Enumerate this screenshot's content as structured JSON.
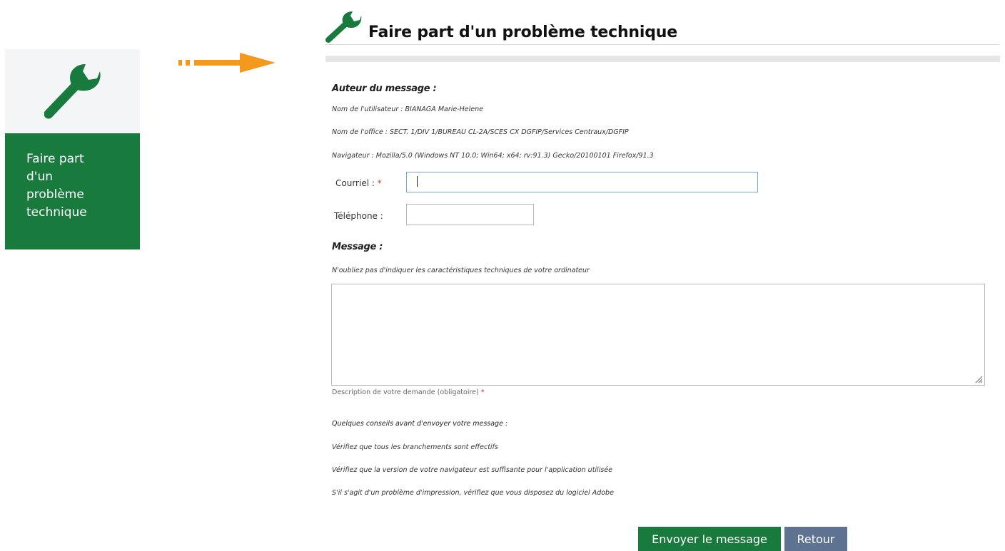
{
  "tile": {
    "label_lines": [
      "Faire part",
      "d'un",
      "problème",
      "technique"
    ],
    "icon": "wrench-icon"
  },
  "arrow": {
    "icon": "arrow-right-icon",
    "color": "#f39a1e"
  },
  "header": {
    "title": "Faire part d'un problème technique",
    "icon": "wrench-icon"
  },
  "author": {
    "heading": "Auteur du message :",
    "user_line": "Nom de l'utilisateur : BIANAGA Marie-Helene",
    "office_line": "Nom de l'office : SECT. 1/DIV 1/BUREAU CL-2A/SCES CX DGFIP/Services Centraux/DGFIP",
    "browser_line": "Navigateur : Mozilla/5.0 (Windows NT 10.0; Win64; x64; rv:91.3) Gecko/20100101 Firefox/91.3"
  },
  "fields": {
    "email_label": "Courriel :",
    "email_required": "*",
    "email_value": "",
    "phone_label": "Téléphone :",
    "phone_value": ""
  },
  "message": {
    "heading": "Message :",
    "hint": "N'oubliez pas d'indiquer les caractéristiques techniques de votre ordinateur",
    "value": "",
    "description": "Description de votre demande (obligatoire)",
    "required": "*"
  },
  "tips": {
    "heading": "Quelques conseils avant d'envoyer votre message :",
    "items": [
      "Vérifiez que tous les branchements sont effectifs",
      "Vérifiez que la version de votre navigateur est suffisante pour l'application utilisée",
      "S'il s'agit d'un problème d'impression, vérifiez que vous disposez du logiciel Adobe"
    ]
  },
  "buttons": {
    "send": "Envoyer le message",
    "back": "Retour"
  },
  "colors": {
    "brand_green": "#197a3e",
    "back_button": "#5e7391",
    "required": "#c0392b"
  }
}
